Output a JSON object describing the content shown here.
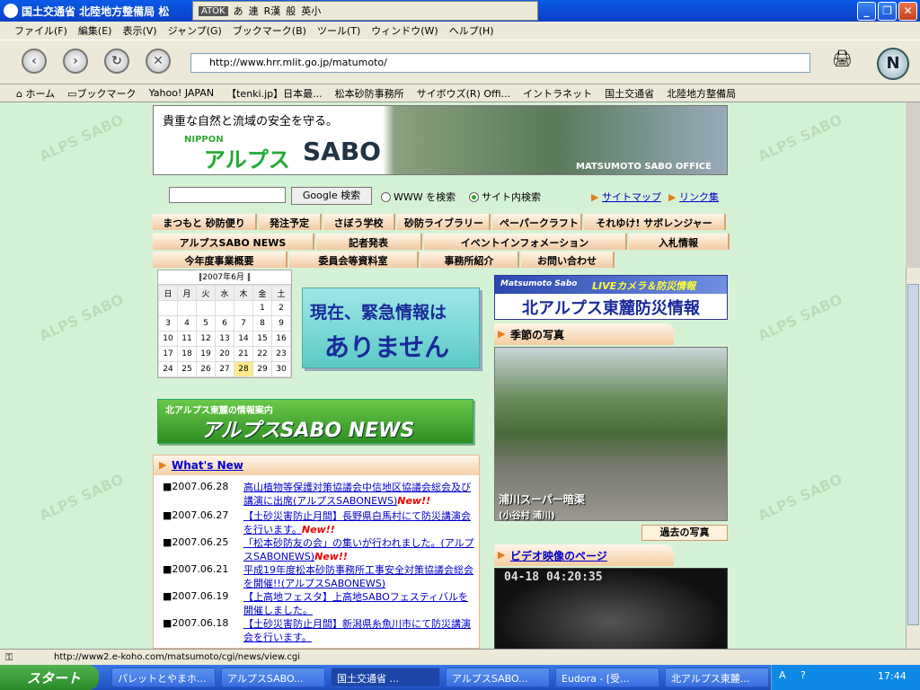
{
  "window": {
    "title": "国土交通省 北陸地方整備局 松"
  },
  "atok": {
    "badge": "ATOK",
    "items": [
      "あ",
      "連",
      "R漢",
      "般",
      "英小"
    ]
  },
  "menu": [
    "ファイル(F)",
    "編集(E)",
    "表示(V)",
    "ジャンプ(G)",
    "ブックマーク(B)",
    "ツール(T)",
    "ウィンドウ(W)",
    "ヘルプ(H)"
  ],
  "nav": {
    "url": "http://www.hrr.mlit.go.jp/matumoto/"
  },
  "bookmarks": [
    "ホーム",
    "ブックマーク",
    "Yahoo! JAPAN",
    "【tenki.jp】日本最...",
    "松本砂防事務所",
    "サイボウズ(R) Offi...",
    "イントラネット",
    "国土交通省",
    "北陸地方整備局"
  ],
  "banner": {
    "slogan": "貴重な自然と流域の安全を守る。",
    "nippon": "NIPPON",
    "alps": "アルプス",
    "sabo": "SABO",
    "office": "MATSUMOTO SABO OFFICE"
  },
  "search": {
    "button": "Google 検索",
    "www": "WWW を検索",
    "site": "サイト内検索",
    "sitemap": "サイトマップ",
    "links": "リンク集"
  },
  "navrows": [
    [
      "まつもと 砂防便り",
      "発注予定",
      "さぼう学校",
      "砂防ライブラリー",
      "ペーパークラフト",
      "それゆけ! サボレンジャー"
    ],
    [
      "アルプスSABO NEWS",
      "記者発表",
      "イベントインフォメーション",
      "入札情報"
    ],
    [
      "今年度事業概要",
      "委員会等資料室",
      "事務所紹介",
      "お問い合わせ"
    ]
  ],
  "calendar": {
    "caption": "‖2007年6月 ‖",
    "days": [
      "日",
      "月",
      "火",
      "水",
      "木",
      "金",
      "土"
    ],
    "weeks": [
      [
        "",
        "",
        "",
        "",
        "",
        "1",
        "2"
      ],
      [
        "3",
        "4",
        "5",
        "6",
        "7",
        "8",
        "9"
      ],
      [
        "10",
        "11",
        "12",
        "13",
        "14",
        "15",
        "16"
      ],
      [
        "17",
        "18",
        "19",
        "20",
        "21",
        "22",
        "23"
      ],
      [
        "24",
        "25",
        "26",
        "27",
        "28",
        "29",
        "30"
      ]
    ],
    "today": "28"
  },
  "emergency": {
    "line1": "現在、緊急情報は",
    "line2": "ありません"
  },
  "newsbanner": {
    "sub": "北アルプス東麓の情報案内",
    "main": "アルプスSABO NEWS"
  },
  "whatsnew": {
    "title": "What's New",
    "items": [
      {
        "date": "■2007.06.28",
        "text": "高山植物等保護対策協議会中信地区協議会総会及び講演に出席(アルプスSABONEWS)",
        "new": "New!!"
      },
      {
        "date": "■2007.06.27",
        "text": "【土砂災害防止月間】長野県白馬村にて防災講演会を行います。",
        "new": "New!!"
      },
      {
        "date": "■2007.06.25",
        "text": "「松本砂防友の会」の集いが行われました。(アルプスSABONEWS)",
        "new": "New!!"
      },
      {
        "date": "■2007.06.21",
        "text": "平成19年度松本砂防事務所工事安全対策協議会総会を開催!!(アルプスSABONEWS)",
        "new": ""
      },
      {
        "date": "■2007.06.19",
        "text": "【上高地フェスタ】上高地SABOフェスティバルを開催しました。",
        "new": ""
      },
      {
        "date": "■2007.06.18",
        "text": "【土砂災害防止月間】新潟県糸魚川市にて防災講演会を行います。",
        "new": ""
      }
    ]
  },
  "disaster": {
    "ms": "Matsumoto Sabo",
    "live": "LIVEカメラ＆防災情報",
    "main": "北アルプス東麓防災情報"
  },
  "photo": {
    "heading": "季節の写真",
    "caption1": "浦川スーパー暗渠",
    "caption2": "(小谷村 浦川)",
    "past": "過去の写真"
  },
  "video": {
    "heading": "ビデオ映像のページ",
    "timestamp": "04-18 04:20:35"
  },
  "status": {
    "url": "http://www2.e-koho.com/matsumoto/cgi/news/view.cgi"
  },
  "taskbar": {
    "start": "スタート",
    "buttons": [
      "パレットとやまホ...",
      "アルプスSABO...",
      "国土交通省 ...",
      "アルプスSABO...",
      "Eudora - [受...",
      "北アルプス東麓..."
    ],
    "clock": "17:44"
  },
  "watermark": "ALPS SABO"
}
